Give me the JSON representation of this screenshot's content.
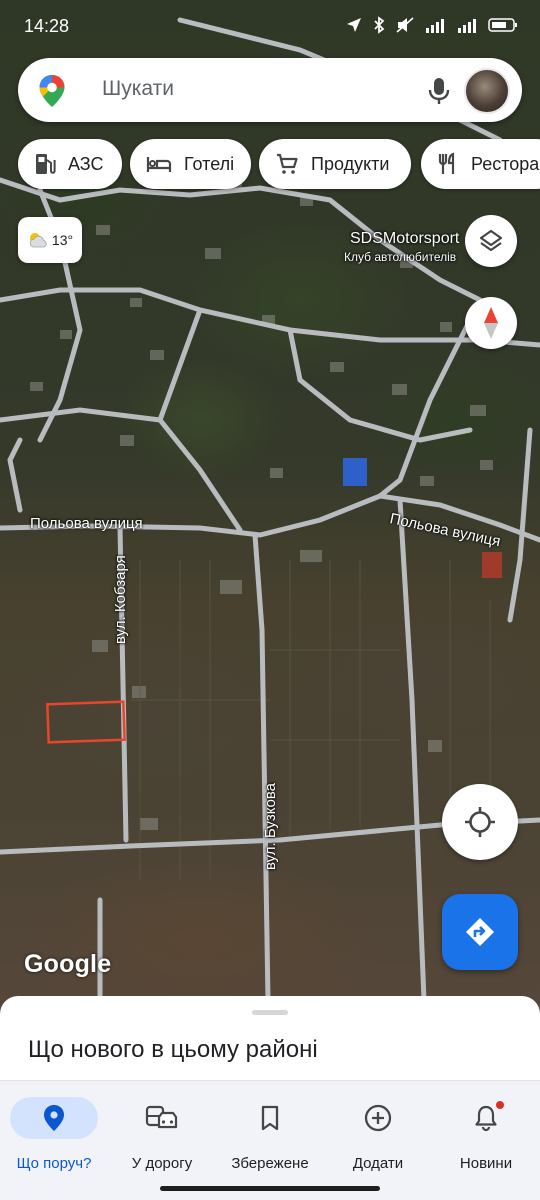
{
  "status_bar": {
    "time": "14:28",
    "icons": [
      "location-arrow-icon",
      "bluetooth-icon",
      "mute-icon",
      "signal-4g-icon",
      "signal-icon",
      "battery-icon"
    ]
  },
  "search": {
    "placeholder": "Шукати",
    "mic_icon": "mic-icon",
    "logo_icon": "maps-pin-icon"
  },
  "chips": [
    {
      "label": "АЗС",
      "icon": "gas-station-icon"
    },
    {
      "label": "Готелі",
      "icon": "bed-icon"
    },
    {
      "label": "Продукти",
      "icon": "cart-icon"
    },
    {
      "label": "Ресторани",
      "icon": "restaurant-icon"
    }
  ],
  "weather": {
    "temp": "13°",
    "icon": "partly-cloudy-icon"
  },
  "map": {
    "labels": {
      "poi_name": "SDSMotorsport",
      "poi_sub": "Клуб автолюбителів",
      "street_left": "Польова вулиця",
      "street_right": "Польова вулиця",
      "street_kobzarya": "вул. Кобзаря",
      "street_buzkova": "вул. Бузкова"
    },
    "google_logo": "Google",
    "accent_color": "#1a73e8",
    "marker_color": "#e8462c"
  },
  "sheet": {
    "title": "Що нового в цьому районі"
  },
  "nav": [
    {
      "label": "Що поруч?",
      "icon": "location-pin-icon",
      "active": true
    },
    {
      "label": "У дорогу",
      "icon": "commute-icon",
      "active": false
    },
    {
      "label": "Збережене",
      "icon": "bookmark-icon",
      "active": false
    },
    {
      "label": "Додати",
      "icon": "add-circle-icon",
      "active": false
    },
    {
      "label": "Новини",
      "icon": "bell-icon",
      "active": false
    }
  ]
}
